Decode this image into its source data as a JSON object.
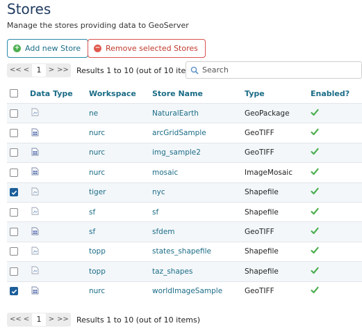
{
  "page": {
    "title": "Stores",
    "subtitle": "Manage the stores providing data to GeoServer"
  },
  "toolbar": {
    "add_label": "Add new Store",
    "remove_label": "Remove selected Stores"
  },
  "pager": {
    "first": "<<",
    "prev": "<",
    "page": "1",
    "next": ">",
    "last": ">>",
    "info": "Results 1 to 10 (out of 10 items)"
  },
  "search": {
    "placeholder": "Search"
  },
  "table": {
    "headers": {
      "data_type": "Data Type",
      "workspace": "Workspace",
      "store_name": "Store Name",
      "type": "Type",
      "enabled": "Enabled?"
    },
    "rows": [
      {
        "checked": false,
        "data_type_icon": "vector-store-icon",
        "workspace": "ne",
        "store_name": "NaturalEarth",
        "type": "GeoPackage",
        "enabled": true
      },
      {
        "checked": false,
        "data_type_icon": "raster-store-icon",
        "workspace": "nurc",
        "store_name": "arcGridSample",
        "type": "GeoTIFF",
        "enabled": true
      },
      {
        "checked": false,
        "data_type_icon": "raster-store-icon",
        "workspace": "nurc",
        "store_name": "img_sample2",
        "type": "GeoTIFF",
        "enabled": true
      },
      {
        "checked": false,
        "data_type_icon": "raster-store-icon",
        "workspace": "nurc",
        "store_name": "mosaic",
        "type": "ImageMosaic",
        "enabled": true
      },
      {
        "checked": true,
        "data_type_icon": "vector-store-icon",
        "workspace": "tiger",
        "store_name": "nyc",
        "type": "Shapefile",
        "enabled": true
      },
      {
        "checked": false,
        "data_type_icon": "vector-store-icon",
        "workspace": "sf",
        "store_name": "sf",
        "type": "Shapefile",
        "enabled": true
      },
      {
        "checked": false,
        "data_type_icon": "raster-store-icon",
        "workspace": "sf",
        "store_name": "sfdem",
        "type": "GeoTIFF",
        "enabled": true
      },
      {
        "checked": false,
        "data_type_icon": "vector-store-icon",
        "workspace": "topp",
        "store_name": "states_shapefile",
        "type": "Shapefile",
        "enabled": true
      },
      {
        "checked": false,
        "data_type_icon": "vector-store-icon",
        "workspace": "topp",
        "store_name": "taz_shapes",
        "type": "Shapefile",
        "enabled": true
      },
      {
        "checked": true,
        "data_type_icon": "raster-store-icon",
        "workspace": "nurc",
        "store_name": "worldImageSample",
        "type": "GeoTIFF",
        "enabled": true
      }
    ]
  },
  "colors": {
    "accent": "#1b6c86",
    "add_border": "#2b8aa8",
    "remove_border": "#d9534f",
    "enabled_check": "#4caf50",
    "checked_box": "#1b5e9a"
  }
}
